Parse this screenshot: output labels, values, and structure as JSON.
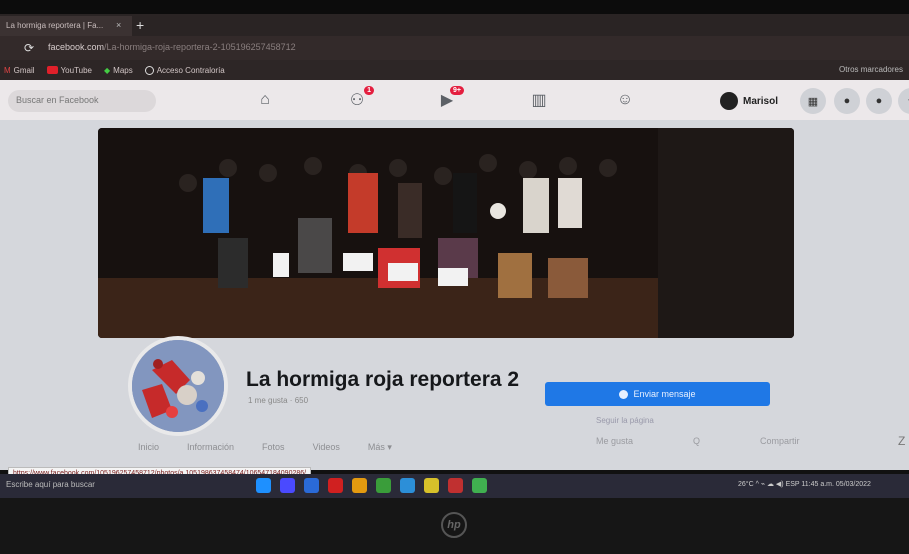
{
  "browser": {
    "tab_title": "La hormiga reportera | Fa...",
    "tab_close": "×",
    "new_tab": "+",
    "url_domain": "facebook.com",
    "url_path": "/La-hormiga-roja-reportera-2-105196257458712",
    "bookmarks": [
      "Gmail",
      "YouTube",
      "Maps",
      "Acceso Contraloría"
    ],
    "bookmarks_right": "Otros marcadores"
  },
  "facebook": {
    "search_placeholder": "Buscar en Facebook",
    "nav_icons": [
      "home-icon",
      "friends-icon",
      "watch-icon",
      "marketplace-icon",
      "groups-icon"
    ],
    "friends_badge": "1",
    "watch_badge": "9+",
    "profile_name": "Marisol"
  },
  "page": {
    "name": "La hormiga roja reportera 2",
    "subtitle": "1 me gusta · 650",
    "send_message": "Enviar mensaje",
    "follow_text": "Seguir la página",
    "tabs": [
      "Inicio",
      "Información",
      "Fotos",
      "Videos",
      "Más ▾"
    ],
    "mini_buttons": [
      "Me gusta",
      "Q",
      "Compartir"
    ],
    "more": "Z"
  },
  "status_url": "https://www.facebook.com/105196257458712/photos/a.105198637458474/106547184090286/",
  "taskbar": {
    "search_text": "Escribe aquí para buscar",
    "tray_text": "26°C  ^ ⌁ ☁ ◀)  ESP  11:45 a.m. 05/03/2022",
    "icon_colors": [
      "#1e90ff",
      "#4a4aff",
      "#2a6ad8",
      "#d02020",
      "#e39a10",
      "#3a9d3a",
      "#2c8fd8",
      "#d7c12a",
      "#c03030",
      "#40b050"
    ]
  },
  "colors": {
    "accent_blue": "#1f78e6",
    "badge_red": "#e41e3f",
    "bezel": "#111111"
  }
}
